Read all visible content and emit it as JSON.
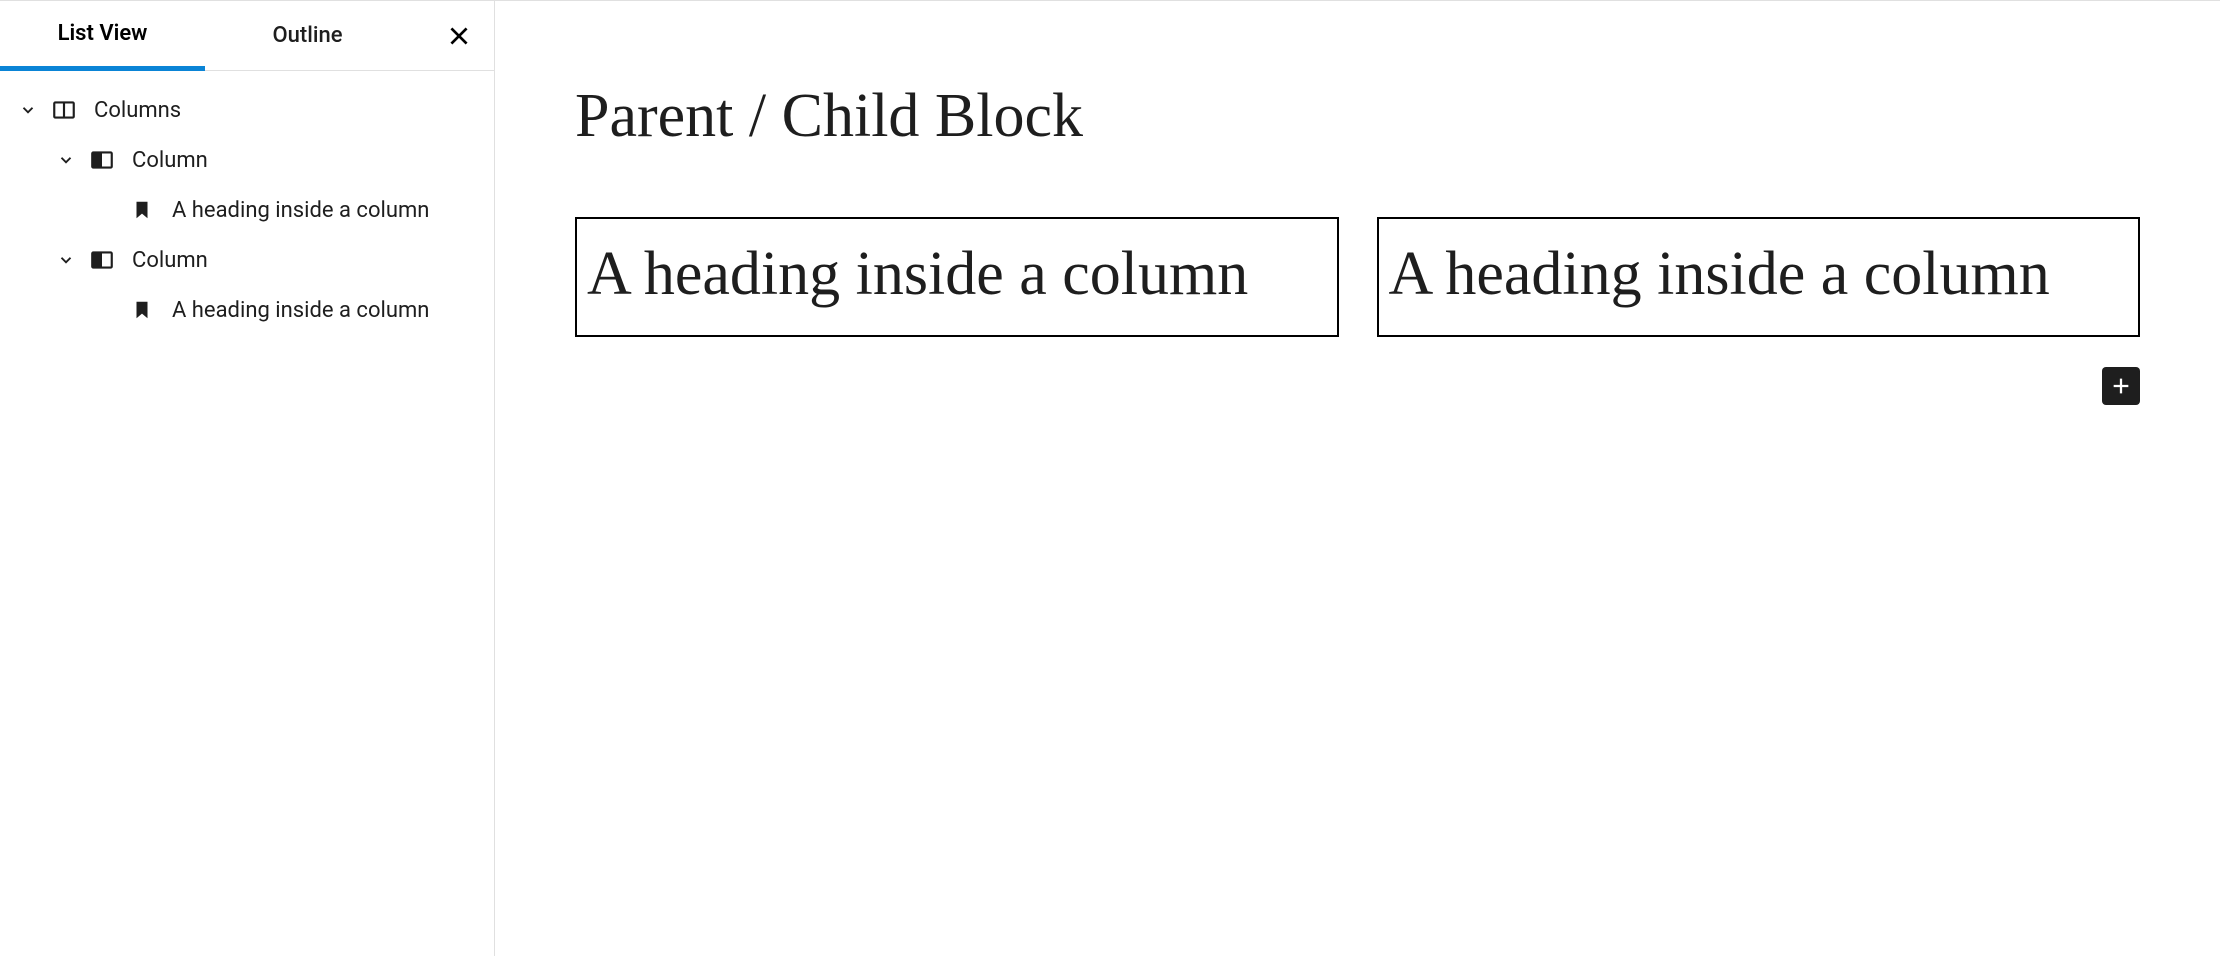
{
  "sidebar": {
    "tabs": {
      "list_view": "List View",
      "outline": "Outline"
    },
    "tree": [
      {
        "depth": 0,
        "icon": "columns",
        "label": "Columns",
        "expandable": true
      },
      {
        "depth": 1,
        "icon": "column",
        "label": "Column",
        "expandable": true
      },
      {
        "depth": 2,
        "icon": "bookmark",
        "label": "A heading inside a column",
        "expandable": false
      },
      {
        "depth": 1,
        "icon": "column",
        "label": "Column",
        "expandable": true
      },
      {
        "depth": 2,
        "icon": "bookmark",
        "label": "A heading inside a column",
        "expandable": false
      }
    ]
  },
  "editor": {
    "title": "Parent / Child Block",
    "columns": [
      {
        "heading": "A heading inside a column"
      },
      {
        "heading": "A heading inside a column"
      }
    ]
  }
}
